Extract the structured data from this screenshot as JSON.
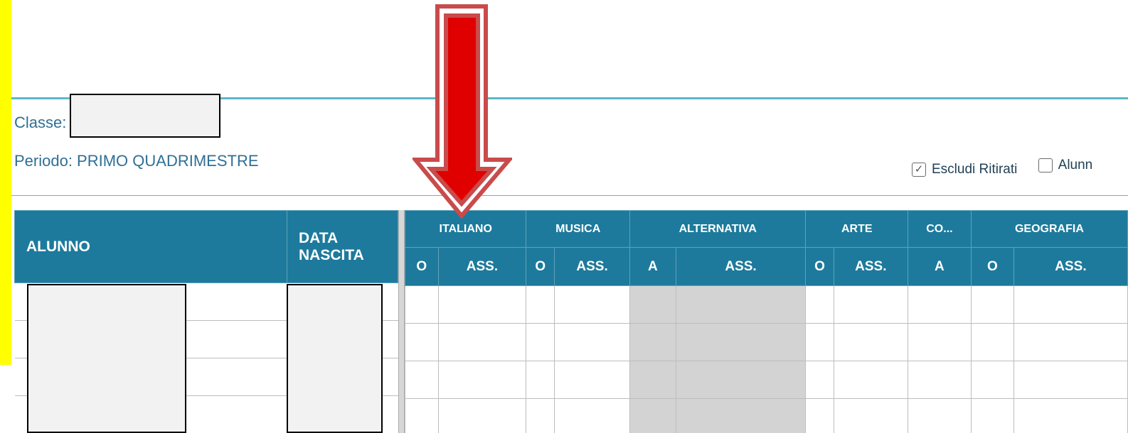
{
  "header": {
    "class_label": "Classe:",
    "period_label": "Periodo: PRIMO QUADRIMESTRE"
  },
  "filters": {
    "escludi_ritirati": {
      "label": "Escludi Ritirati",
      "checked": true
    },
    "alunni": {
      "label": "Alunn",
      "checked": false
    }
  },
  "table": {
    "left_headers": [
      "ALUNNO",
      "DATA NASCITA"
    ],
    "subjects": [
      "ITALIANO",
      "MUSICA",
      "ALTERNATIVA",
      "ARTE",
      "CO...",
      "GEOGRAFIA"
    ],
    "subheaders": [
      "O",
      "ASS.",
      "O",
      "ASS.",
      "A",
      "ASS.",
      "O",
      "ASS.",
      "A",
      "O",
      "ASS."
    ],
    "row_count": 4
  },
  "colors": {
    "accent": "#5bb9c3",
    "header_bg": "#1d7a9c",
    "label_text": "#2f6f95",
    "highlight_arrow": "#e00000",
    "yellow_bar": "#ffff00"
  }
}
